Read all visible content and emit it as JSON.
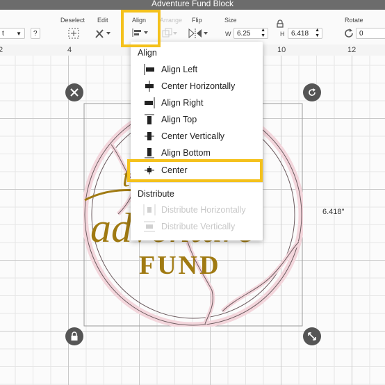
{
  "window": {
    "title": "Adventure Fund Block"
  },
  "toolbar": {
    "font_select": "t",
    "help": "?",
    "deselect": "Deselect",
    "edit": "Edit",
    "align": "Align",
    "arrange": "Arrange",
    "flip": "Flip",
    "size": "Size",
    "w_label": "W",
    "w_value": "6.25",
    "h_label": "H",
    "h_value": "6.418",
    "rotate": "Rotate",
    "rotate_value": "0"
  },
  "ruler": {
    "ticks": [
      "2",
      "4",
      "10",
      "12"
    ]
  },
  "canvas": {
    "height_label": "6.418\"",
    "design": {
      "word1": "adventure",
      "word2": "FUND",
      "script_top": "the"
    }
  },
  "align_menu": {
    "header": "Align",
    "items": [
      {
        "label": "Align Left"
      },
      {
        "label": "Center Horizontally"
      },
      {
        "label": "Align Right"
      },
      {
        "label": "Align Top"
      },
      {
        "label": "Center Vertically"
      },
      {
        "label": "Align Bottom"
      },
      {
        "label": "Center"
      }
    ],
    "distribute_header": "Distribute",
    "distribute_items": [
      {
        "label": "Distribute Horizontally"
      },
      {
        "label": "Distribute Vertically"
      }
    ]
  },
  "colors": {
    "highlight": "#f4c11c",
    "gold": "#a07a12",
    "pink": "#f3d6dc"
  }
}
